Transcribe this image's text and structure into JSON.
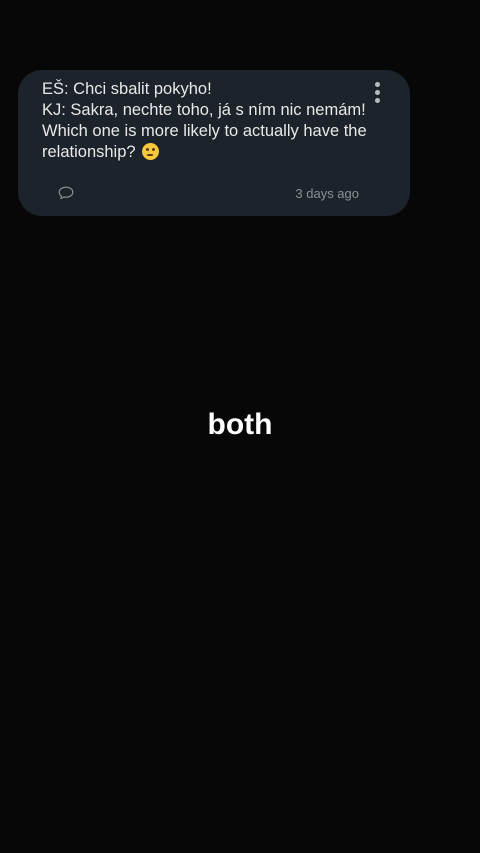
{
  "post": {
    "lines": [
      "EŠ: Chci sbalit pokyho!",
      "KJ: Sakra, nechte toho, já s ním nic nemám!",
      "Which one is more likely to actually have the",
      "relationship?"
    ],
    "emoji": "thinking-face",
    "timestamp": "3 days ago"
  },
  "caption": "both",
  "colors": {
    "background": "#070707",
    "card": "#1d232a",
    "text": "#e8e8e8",
    "muted": "#8b9096"
  }
}
